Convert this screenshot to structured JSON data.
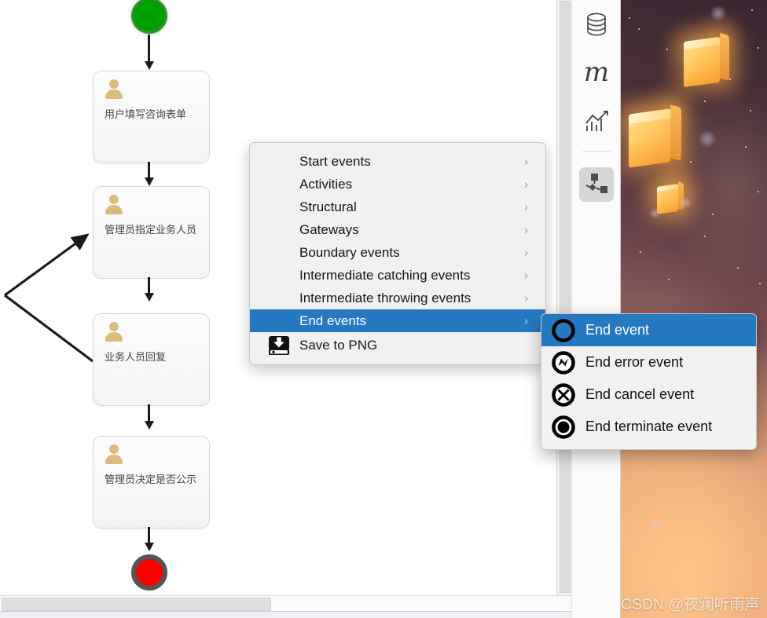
{
  "app": {
    "canvas_background": "#ffffff",
    "accent_color": "#2579c0",
    "menu_background": "#f1f1f1"
  },
  "diagram": {
    "type": "bpmn-flowchart",
    "start_event": {
      "name": "start-event",
      "color": "#00a000"
    },
    "end_event": {
      "name": "end-event",
      "color": "#fe0000"
    },
    "tasks": [
      {
        "label": "用户填写咨询表单",
        "icon": "user-task-icon"
      },
      {
        "label": "管理员指定业务人员",
        "icon": "user-task-icon"
      },
      {
        "label": "业务人员回复",
        "icon": "user-task-icon"
      },
      {
        "label": "管理员决定是否公示",
        "icon": "user-task-icon"
      }
    ]
  },
  "context_menu": {
    "items": [
      {
        "label": "Start events",
        "has_submenu": true,
        "selected": false
      },
      {
        "label": "Activities",
        "has_submenu": true,
        "selected": false
      },
      {
        "label": "Structural",
        "has_submenu": true,
        "selected": false
      },
      {
        "label": "Gateways",
        "has_submenu": true,
        "selected": false
      },
      {
        "label": "Boundary events",
        "has_submenu": true,
        "selected": false
      },
      {
        "label": "Intermediate catching events",
        "has_submenu": true,
        "selected": false
      },
      {
        "label": "Intermediate throwing events",
        "has_submenu": true,
        "selected": false
      },
      {
        "label": "End events",
        "has_submenu": true,
        "selected": true
      }
    ],
    "chevron": "›",
    "save_item": {
      "label": "Save to PNG",
      "icon": "save-disk-icon"
    }
  },
  "submenu": {
    "items": [
      {
        "label": "End event",
        "icon": "end-event-icon",
        "selected": true
      },
      {
        "label": "End error event",
        "icon": "end-error-event-icon",
        "selected": false
      },
      {
        "label": "End cancel event",
        "icon": "end-cancel-event-icon",
        "selected": false
      },
      {
        "label": "End terminate event",
        "icon": "end-terminate-event-icon",
        "selected": false
      }
    ]
  },
  "tool_rail": {
    "buttons": [
      {
        "name": "database-icon",
        "selected": false
      },
      {
        "name": "m-letter-icon",
        "label": "m",
        "selected": false
      },
      {
        "name": "chart-icon",
        "selected": false
      },
      {
        "name": "diagram-icon",
        "selected": true
      }
    ]
  },
  "desktop": {
    "wallpaper": "floating-paper-lanterns-night-sky",
    "watermark": "CSDN @夜澜听雨声"
  }
}
